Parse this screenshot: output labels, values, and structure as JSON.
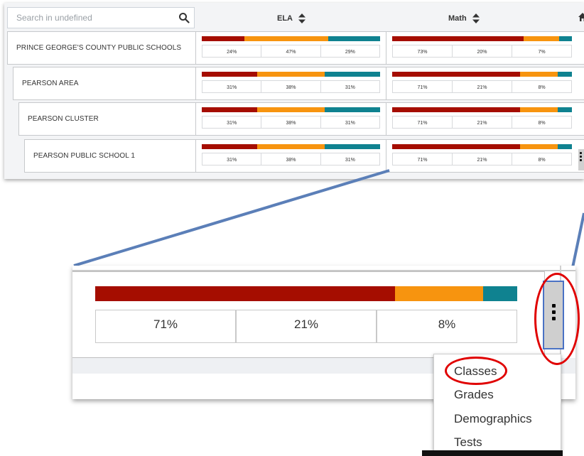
{
  "search": {
    "placeholder": "Search in undefined"
  },
  "columns": [
    {
      "label": "ELA",
      "sort_icon": "sort-icon"
    },
    {
      "label": "Math",
      "sort_icon": "sort-icon"
    }
  ],
  "home_icon": "home-icon",
  "colors": {
    "red": "#a50d00",
    "orange": "#f7940f",
    "teal": "#0f8290",
    "highlight": "#e00000",
    "connector": "#5b7fb8"
  },
  "rows": [
    {
      "name": "PRINCE GEORGE'S COUNTY PUBLIC SCHOOLS",
      "ela": [
        "24%",
        "47%",
        "29%"
      ],
      "math": [
        "73%",
        "20%",
        "7%"
      ]
    },
    {
      "name": "PEARSON AREA",
      "ela": [
        "31%",
        "38%",
        "31%"
      ],
      "math": [
        "71%",
        "21%",
        "8%"
      ]
    },
    {
      "name": "PEARSON CLUSTER",
      "ela": [
        "31%",
        "38%",
        "31%"
      ],
      "math": [
        "71%",
        "21%",
        "8%"
      ]
    },
    {
      "name": "PEARSON PUBLIC SCHOOL 1",
      "ela": [
        "31%",
        "38%",
        "31%"
      ],
      "math": [
        "71%",
        "21%",
        "8%"
      ]
    }
  ],
  "row_fractions": [
    {
      "ela": [
        0.24,
        0.47,
        0.29
      ],
      "math": [
        0.73,
        0.2,
        0.07
      ]
    },
    {
      "ela": [
        0.31,
        0.38,
        0.31
      ],
      "math": [
        0.71,
        0.21,
        0.08
      ]
    },
    {
      "ela": [
        0.31,
        0.38,
        0.31
      ],
      "math": [
        0.71,
        0.21,
        0.08
      ]
    },
    {
      "ela": [
        0.31,
        0.38,
        0.31
      ],
      "math": [
        0.71,
        0.21,
        0.08
      ]
    }
  ],
  "zoom": {
    "values": [
      "71%",
      "21%",
      "8%"
    ],
    "fractions": [
      0.71,
      0.21,
      0.08
    ]
  },
  "menu": {
    "items": [
      "Classes",
      "Grades",
      "Demographics",
      "Tests"
    ],
    "highlighted": "Classes"
  }
}
